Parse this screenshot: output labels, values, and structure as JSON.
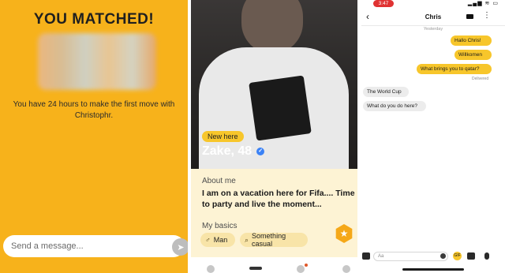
{
  "match_screen": {
    "title": "YOU MATCHED!",
    "message": "You have 24 hours to make the first move with Christophr.",
    "input_placeholder": "Send a message...",
    "send_icon": "send-icon"
  },
  "profile_screen": {
    "badge": "New here",
    "name": "Zake, 48",
    "verified_icon": "verified-icon",
    "about_heading": "About me",
    "about_text": "I am on a vacation here for Fifa.... Time to party and live the moment...",
    "basics_heading": "My basics",
    "basics": [
      {
        "icon": "gender-icon",
        "label": "Man"
      },
      {
        "icon": "search-icon",
        "label": "Something casual"
      }
    ],
    "star_icon": "star-icon"
  },
  "chat_screen": {
    "status_time": "3:47",
    "contact_name": "Chris",
    "day_label": "Yesterday",
    "messages": [
      {
        "side": "out",
        "text": "Hallo Chris!"
      },
      {
        "side": "out",
        "text": "Willkomen"
      },
      {
        "side": "out",
        "text": "What brings you to qatar?"
      },
      {
        "side": "in",
        "text": "The World Cup"
      },
      {
        "side": "in",
        "text": "What do you do here?"
      }
    ],
    "delivered_label": "Delivered",
    "input_placeholder": "Aa",
    "gif_label": "GIF"
  },
  "colors": {
    "brand_yellow": "#f7b21b",
    "bubble_yellow": "#f7c62b",
    "profile_card": "#fdf3d4",
    "chip": "#f8e4a8",
    "verified": "#3b82f6",
    "status_red": "#e03232"
  }
}
